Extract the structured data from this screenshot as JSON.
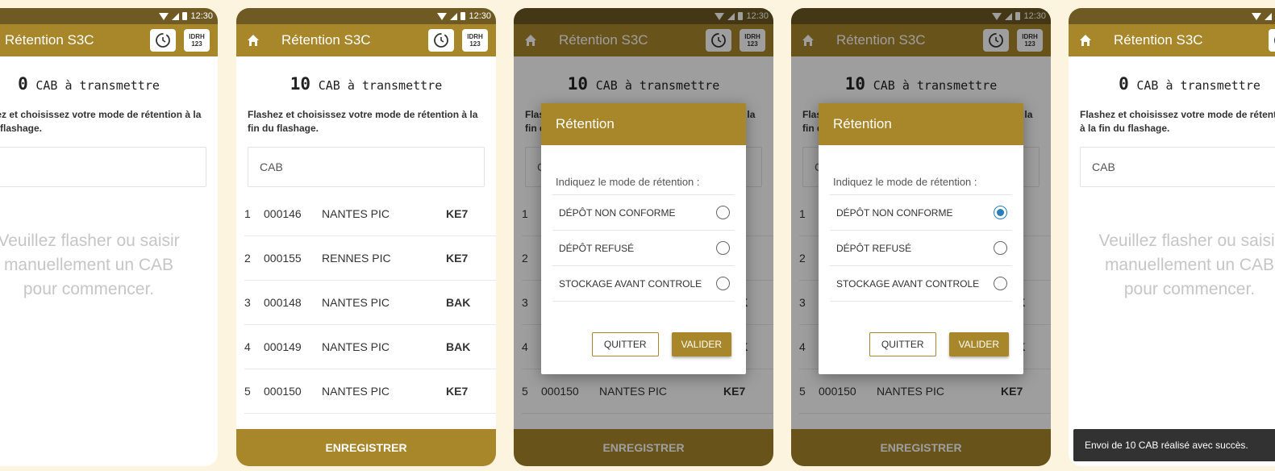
{
  "status": {
    "time": "12:30"
  },
  "app": {
    "title": "Rétention S3C",
    "idrh_top": "IDRH",
    "idrh_bottom": "123"
  },
  "screen_empty": {
    "count": "0",
    "count_label": "CAB à transmettre",
    "instructions": "Flashez et choisissez votre mode de rétention à la fin du flashage.",
    "cab_placeholder": "CAB",
    "empty_line1": "Veuillez flasher ou saisir",
    "empty_line2": "manuellement un CAB",
    "empty_line3": "pour commencer."
  },
  "screen_list": {
    "count": "10",
    "count_label": "CAB à transmettre",
    "instructions": "Flashez et choisissez votre mode de rétention à la fin du flashage.",
    "cab_placeholder": "CAB",
    "rows": [
      {
        "idx": "1",
        "code": "000146",
        "city": "NANTES PIC",
        "tag": "KE7"
      },
      {
        "idx": "2",
        "code": "000155",
        "city": "RENNES PIC",
        "tag": "KE7"
      },
      {
        "idx": "3",
        "code": "000148",
        "city": "NANTES PIC",
        "tag": "BAK"
      },
      {
        "idx": "4",
        "code": "000149",
        "city": "NANTES PIC",
        "tag": "BAK"
      },
      {
        "idx": "5",
        "code": "000150",
        "city": "NANTES PIC",
        "tag": "KE7"
      }
    ],
    "save_label": "ENREGISTRER"
  },
  "dialog": {
    "title": "Rétention",
    "prompt": "Indiquez le mode de rétention :",
    "options": [
      "DÉPÔT NON CONFORME",
      "DÉPÔT REFUSÉ",
      "STOCKAGE AVANT CONTROLE"
    ],
    "quit_label": "QUITTER",
    "ok_label": "VALIDER",
    "selected_in_second_screen": "DÉPÔT NON CONFORME"
  },
  "snackbar": {
    "message": "Envoi de 10 CAB réalisé avec succès."
  },
  "colors": {
    "primary": "#a8862a",
    "statusbar": "#6e5a22",
    "background": "#fdf4e0",
    "radio_selected": "#2b7fb8"
  }
}
